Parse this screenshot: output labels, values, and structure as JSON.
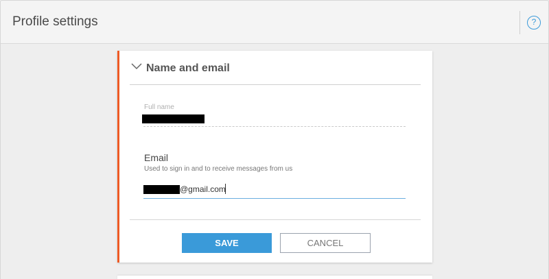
{
  "header": {
    "title": "Profile settings",
    "help_icon": "question-circle-icon",
    "help_glyph": "?",
    "accent_color": "#3a9ad9"
  },
  "card": {
    "title": "Name and email",
    "accent_color": "#ee5a24",
    "collapse_icon": "chevron-down-icon",
    "full_name": {
      "label": "Full name",
      "value_redacted": true
    },
    "email": {
      "label": "Email",
      "help_text": "Used to sign in and to receive messages from us",
      "value_visible_suffix": "@gmail.com",
      "value_redacted_prefix": true
    },
    "save_label": "SAVE",
    "cancel_label": "CANCEL"
  }
}
